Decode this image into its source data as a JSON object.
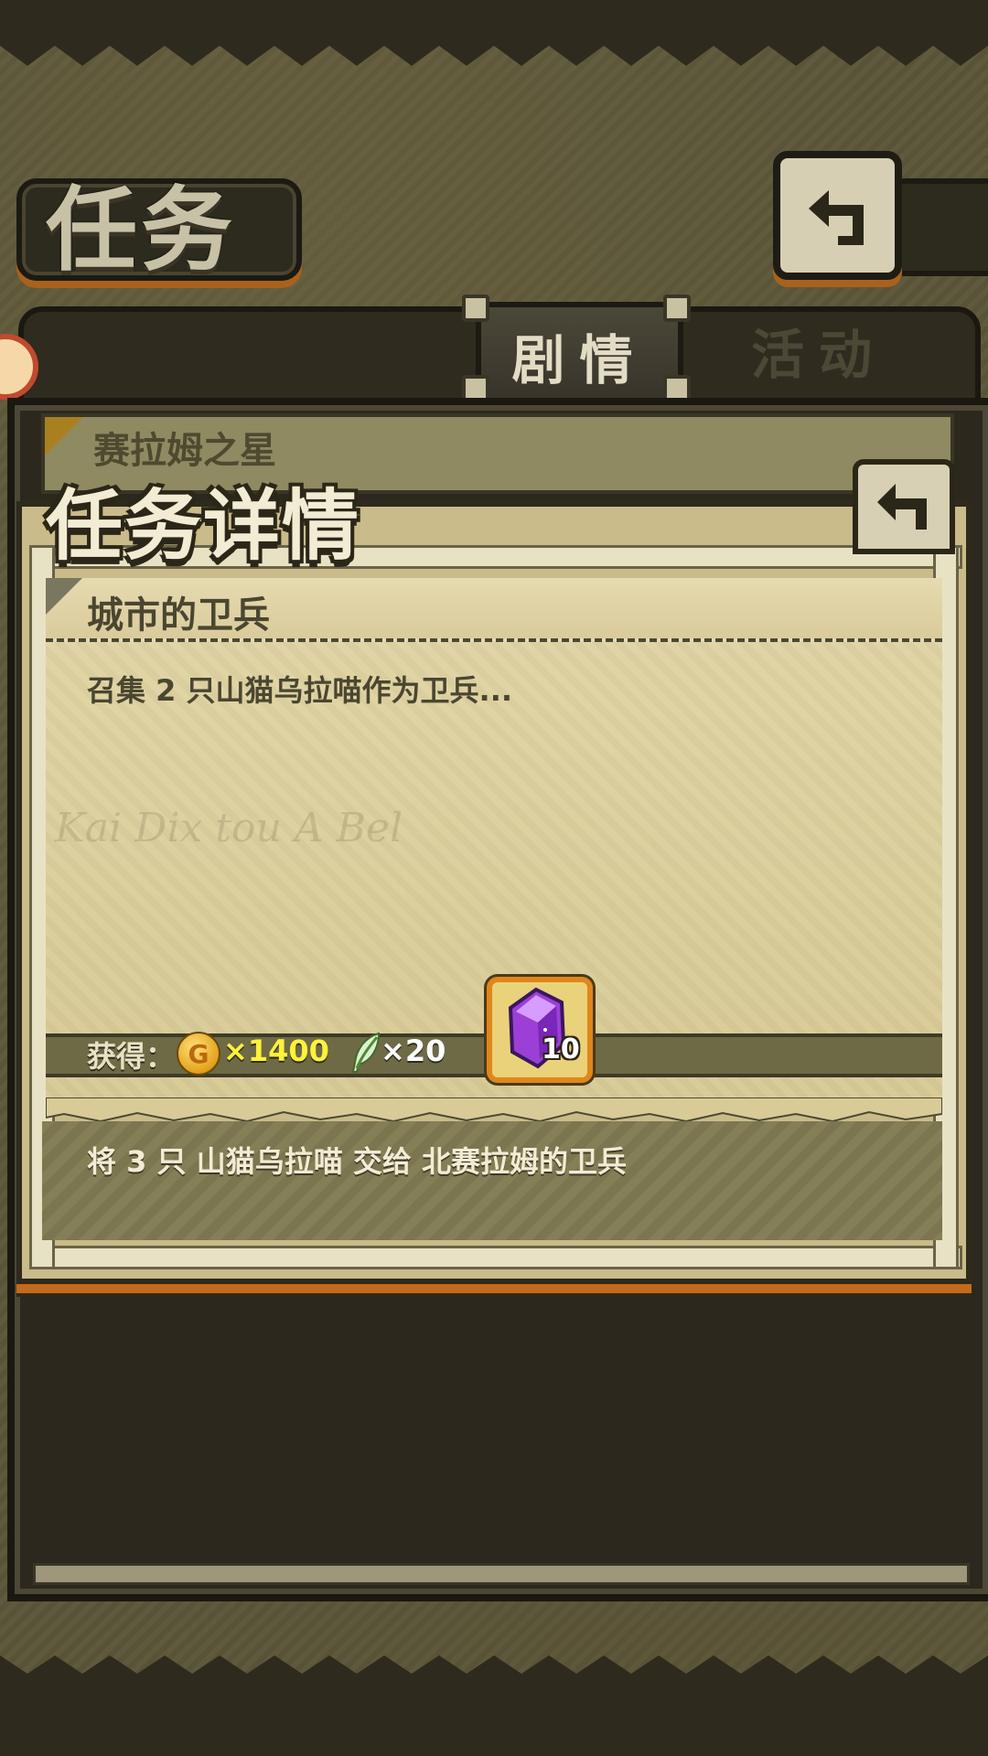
{
  "header": {
    "title": "任务"
  },
  "tabs": [
    {
      "label": "剧情",
      "active": true
    },
    {
      "label": "活动",
      "active": false
    }
  ],
  "mission_list": {
    "first_item": "赛拉姆之星"
  },
  "dialog": {
    "title": "任务详情",
    "quest_name": "城市的卫兵",
    "description": "召集 2 只山猫乌拉喵作为卫兵...",
    "rewards": {
      "label": "获得：",
      "gold_amount": "×1400",
      "feather_amount": "×20",
      "gem_count": "10"
    },
    "hand_in": "将 3 只 山猫乌拉喵 交给 北赛拉姆的卫兵"
  },
  "colors": {
    "accent_orange": "#c46a1a",
    "gold_text": "#fff23a",
    "parchment": "#d8cb98"
  },
  "icons": [
    "back-arrow-icon",
    "gold-coin-icon",
    "feather-icon",
    "purple-crystal-icon"
  ]
}
